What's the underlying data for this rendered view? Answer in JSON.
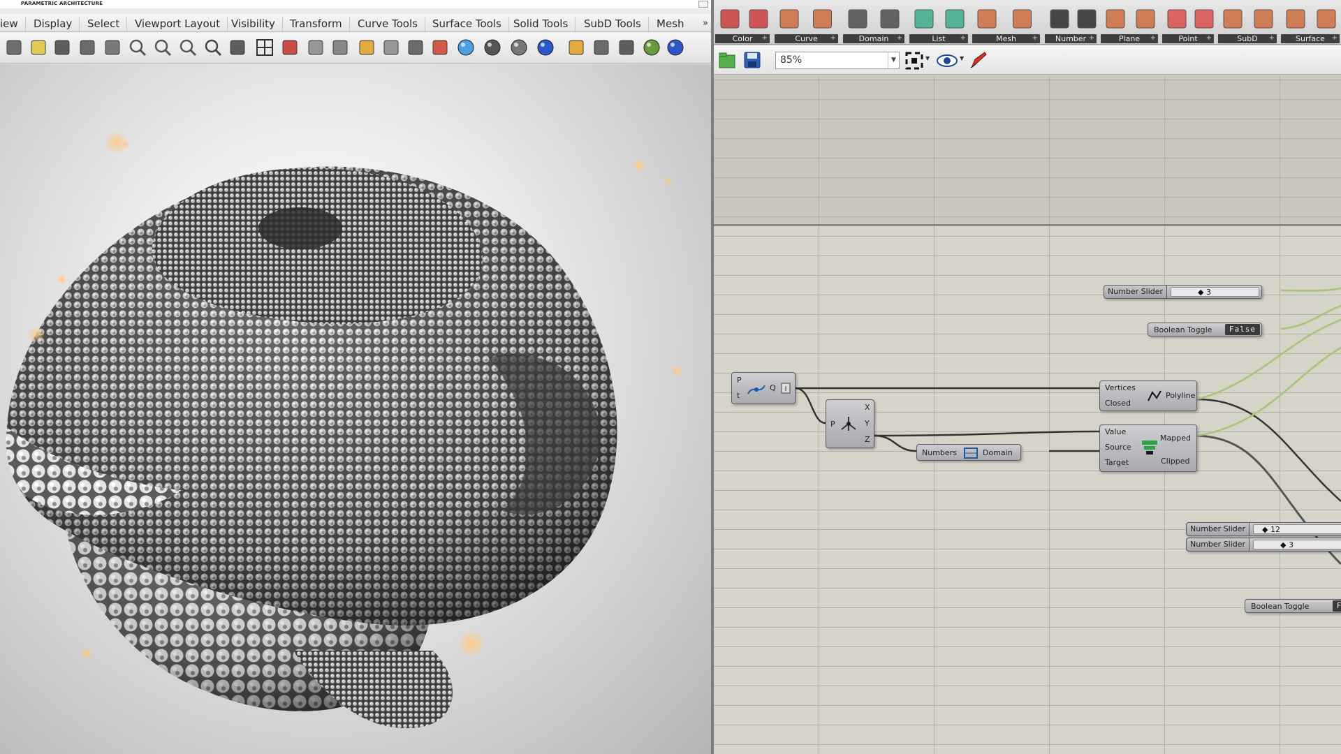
{
  "rhino": {
    "title": "PARAMETRIC ARCHITECTURE",
    "menu_tabs": [
      "iew",
      "Display",
      "Select",
      "Viewport Layout",
      "Visibility",
      "Transform",
      "Curve Tools",
      "Surface Tools",
      "Solid Tools",
      "SubD Tools",
      "Mesh"
    ],
    "more_tabs": "»",
    "toolbar_icons": [
      "new-file-icon",
      "paste-icon",
      "undo-icon",
      "pan-icon",
      "move-icon",
      "zoom-icon",
      "zoom-window-icon",
      "zoom-extents-icon",
      "zoom-selected-icon",
      "rotate-view-icon",
      "grid-icon",
      "car-icon",
      "hide-icon",
      "circle-icon",
      "point-icon",
      "light-icon",
      "lock-icon",
      "layer-icon",
      "color-wheel-icon",
      "shade-icon",
      "render-sphere-icon",
      "blue-sphere-icon",
      "light-pen-icon",
      "gear-icon",
      "snap-icon",
      "globe-icon",
      "help-icon"
    ]
  },
  "gh": {
    "ribbon_groups": [
      "Color",
      "Curve",
      "Domain",
      "List",
      "Mesh",
      "Number",
      "Plane",
      "Point",
      "SubD",
      "Surface"
    ],
    "zoom": "85%",
    "nodes": {
      "slider1": {
        "label": "Number Slider",
        "value": "◆ 3"
      },
      "toggle1": {
        "label": "Boolean Toggle",
        "value": "False"
      },
      "pt_inputs": [
        "P",
        "t"
      ],
      "pt_mid": "Q",
      "decompose": {
        "input": "P",
        "outputs": [
          "X",
          "Y",
          "Z"
        ]
      },
      "polyline": {
        "inputs": [
          "Vertices",
          "Closed"
        ],
        "label": "Polyline"
      },
      "bounds": {
        "input": "Numbers",
        "output": "Domain"
      },
      "remap": {
        "inputs": [
          "Value",
          "Source",
          "Target"
        ],
        "outputs": [
          "Mapped",
          "Clipped"
        ]
      },
      "slider2": {
        "label": "Number Slider",
        "value": "◆ 12"
      },
      "slider3": {
        "label": "Number Slider",
        "value": "◆ 3"
      },
      "toggle2": {
        "label": "Boolean Toggle",
        "value": "Fa"
      }
    }
  }
}
